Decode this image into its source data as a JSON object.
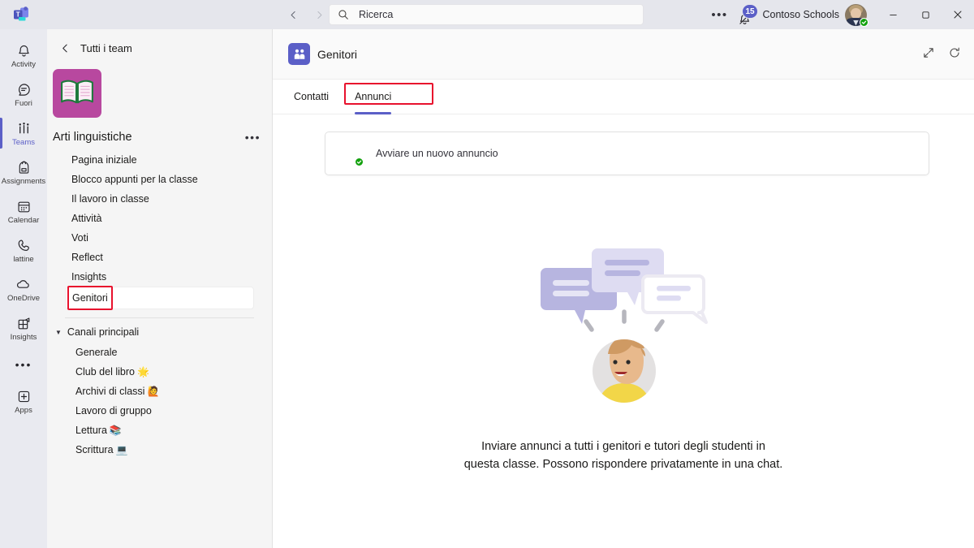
{
  "titlebar": {
    "logo_icon": "teams-logo-icon",
    "back_icon": "chevron-left-icon",
    "forward_icon": "chevron-right-icon",
    "ellipsis": "•••",
    "search": {
      "value": "Ricerca",
      "placeholder": "Ricerca",
      "icon": "search-icon"
    },
    "notifications": {
      "icon": "bell-icon",
      "badge_count": "15"
    },
    "org_name": "Contoso Schools",
    "avatar": {
      "name": "user-avatar",
      "presence": "available"
    },
    "window_controls": {
      "minimize": "−",
      "maximize": "❐",
      "close": "✕"
    }
  },
  "rail": {
    "items": [
      {
        "label": "Activity",
        "icon": "bell-icon",
        "active": false
      },
      {
        "label": "Fuori",
        "icon": "chat-icon",
        "active": false
      },
      {
        "label": "Teams",
        "icon": "teams-icon",
        "active": true
      },
      {
        "label": "Assignments",
        "icon": "backpack-icon",
        "active": false
      },
      {
        "label": "Calendar",
        "icon": "calendar-icon",
        "active": false
      },
      {
        "label": "lattine",
        "icon": "phone-icon",
        "active": false
      },
      {
        "label": "OneDrive",
        "icon": "cloud-icon",
        "active": false
      },
      {
        "label": "Insights",
        "icon": "insights-icon",
        "active": false
      }
    ],
    "more_icon": "more-apps-icon",
    "apps": {
      "label": "Apps",
      "icon": "plus-box-icon"
    }
  },
  "sidebar": {
    "back_label": "Tutti i team",
    "back_icon": "chevron-left-icon",
    "team": {
      "name": "Arti linguistiche",
      "avatar_icon": "open-book-icon",
      "avatar_color": "#b8489f",
      "more_icon": "more-options-icon"
    },
    "nav_items": [
      {
        "label": "Pagina iniziale",
        "selected": false
      },
      {
        "label": "Blocco appunti per la classe",
        "selected": false
      },
      {
        "label": "Il lavoro in classe",
        "selected": false
      },
      {
        "label": "Attività",
        "selected": false
      },
      {
        "label": "Voti",
        "selected": false
      },
      {
        "label": "Reflect",
        "selected": false
      },
      {
        "label": "Insights",
        "selected": false
      },
      {
        "label": "Genitori",
        "selected": true,
        "highlighted": true
      }
    ],
    "group": {
      "label": "Canali principali",
      "caret_icon": "caret-down-icon",
      "channels": [
        {
          "label": "Generale",
          "emoji": ""
        },
        {
          "label": "Club del libro",
          "emoji": "🌟"
        },
        {
          "label": "Archivi di classi",
          "emoji": "🙋"
        },
        {
          "label": "Lavoro di gruppo",
          "emoji": ""
        },
        {
          "label": "Lettura",
          "emoji": "📚"
        },
        {
          "label": "Scrittura",
          "emoji": "💻"
        }
      ]
    }
  },
  "main": {
    "header": {
      "app_icon": "parents-people-icon",
      "app_icon_color": "#5b5fc7",
      "title": "Genitori",
      "expand_icon": "expand-diagonal-icon",
      "refresh_icon": "refresh-icon"
    },
    "tabs": [
      {
        "label": "Contatti",
        "active": false,
        "highlighted": false
      },
      {
        "label": "Annunci",
        "active": true,
        "highlighted": true
      }
    ],
    "compose": {
      "placeholder": "Avviare un nuovo annuncio",
      "avatar": {
        "name": "teacher-avatar",
        "presence": "available"
      }
    },
    "empty_state": {
      "illustration": "speech-bubbles-person-illustration",
      "caption_line1": "Inviare annunci a tutti i genitori e tutori degli studenti in",
      "caption_line2": "questa classe. Possono rispondere privatamente in una chat."
    }
  },
  "colors": {
    "accent": "#5b5fc7",
    "highlight_box": "#e8112d",
    "rail_bg": "#e9eaf0",
    "sidebar_bg": "#f5f5f5",
    "titlebar_bg": "#e5e6ec",
    "presence_available": "#13a10e"
  }
}
